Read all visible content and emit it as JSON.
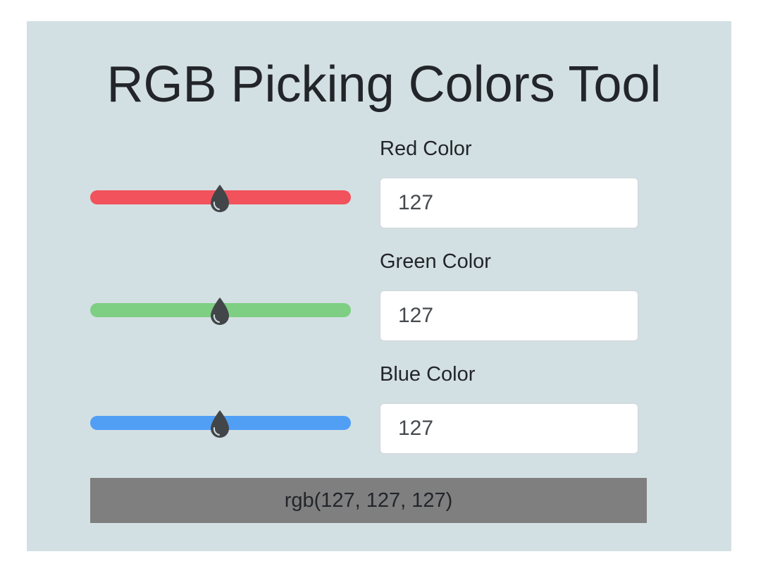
{
  "page": {
    "title": "RGB Picking Colors Tool"
  },
  "channels": [
    {
      "label": "Red Color",
      "value": "127",
      "max": 255,
      "color": "#f2525b"
    },
    {
      "label": "Green Color",
      "value": "127",
      "max": 255,
      "color": "#7ecf83"
    },
    {
      "label": "Blue Color",
      "value": "127",
      "max": 255,
      "color": "#519ff5"
    }
  ],
  "slider": {
    "thumb_icon": "droplet-icon",
    "thumb_color": "#424649"
  },
  "result": {
    "text": "rgb(127, 127, 127)",
    "color": "#7f7f7f"
  }
}
